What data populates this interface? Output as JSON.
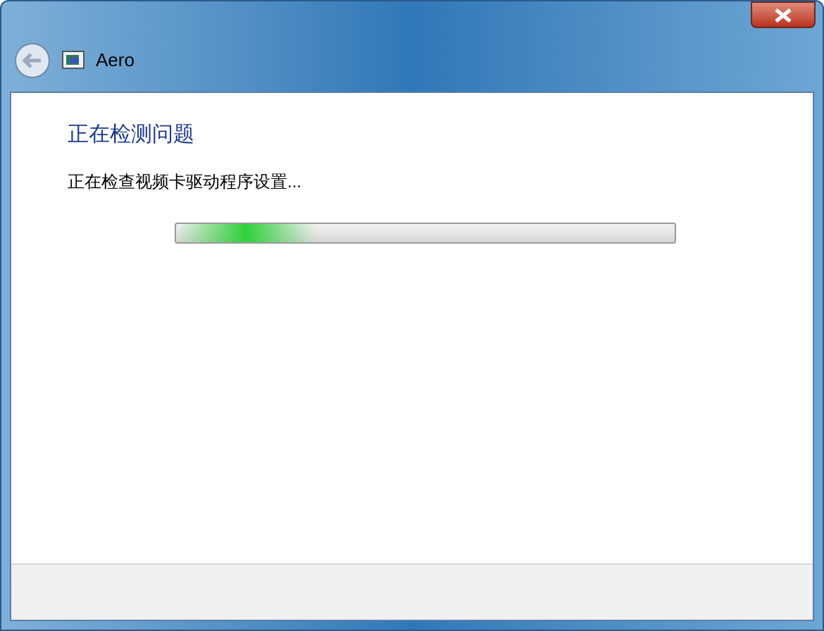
{
  "window": {
    "title": "Aero"
  },
  "heading": "正在检测问题",
  "status": "正在检查视频卡驱动程序设置...",
  "progress": {
    "level": 0.28
  }
}
